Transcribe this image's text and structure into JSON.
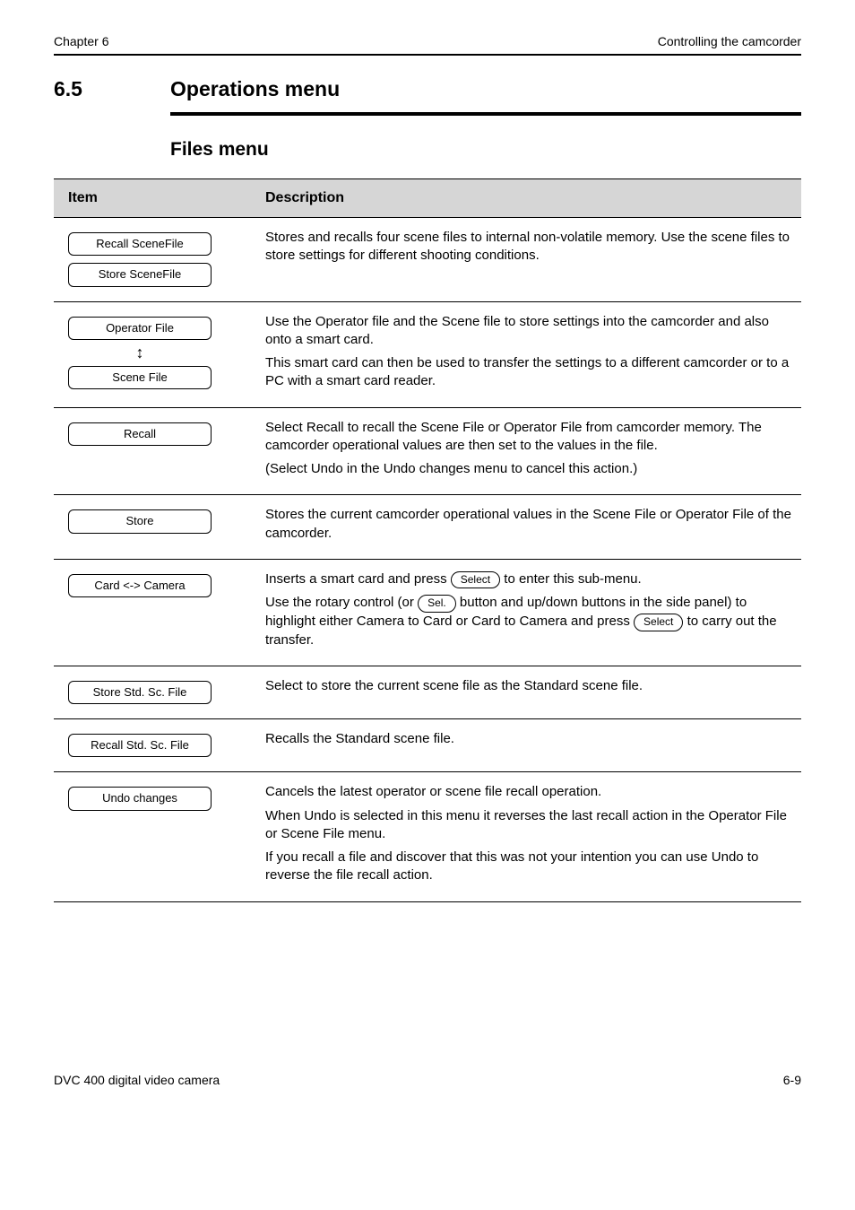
{
  "header": {
    "chapter_label": "Chapter 6",
    "chapter_title": "Controlling the camcorder"
  },
  "section": {
    "number": "6.5",
    "title": "Operations menu",
    "subheading": "Files menu"
  },
  "table": {
    "head": {
      "item": "Item",
      "description": "Description"
    },
    "rows": [
      {
        "buttons": [
          "Recall SceneFile",
          "Store SceneFile"
        ],
        "desc": [
          "Stores and recalls four scene files to internal non-volatile memory. Use the scene files to store settings for different shooting conditions."
        ]
      },
      {
        "buttons": [
          "Operator File",
          "Scene File"
        ],
        "has_updown": true,
        "desc": [
          "Use the Operator file and the Scene file to store settings into the camcorder and also onto a smart card.",
          "This smart card can then be used to transfer the settings to a different camcorder or to a PC with a smart card reader."
        ]
      },
      {
        "buttons": [
          "Recall"
        ],
        "desc": [
          "Select Recall to recall the Scene File or Operator File from camcorder memory. The camcorder operational values are then set to the values in the file.",
          "(Select Undo in the Undo changes menu to cancel this action.)"
        ]
      },
      {
        "buttons": [
          "Store"
        ],
        "desc": [
          "Stores the current camcorder operational values in the Scene File or Operator File of the camcorder."
        ]
      },
      {
        "buttons": [
          "Card <-> Camera"
        ],
        "btn_sm": [
          "Select",
          "Sel.",
          "Select"
        ],
        "desc_parts": {
          "p1_pre": "Inserts a smart card and press ",
          "p1_post": " to enter this sub-menu.",
          "p2_pre": "Use the rotary control (or ",
          "p2_post": " button and up/down buttons in the side panel) to highlight either Camera to Card or Card to Camera and press ",
          "p2_end": " to carry out the transfer."
        }
      },
      {
        "buttons": [
          "Store Std. Sc. File"
        ],
        "desc": [
          "Select to store the current scene file as the Standard scene file."
        ]
      },
      {
        "buttons": [
          "Recall Std. Sc. File"
        ],
        "desc": [
          "Recalls the Standard scene file."
        ]
      },
      {
        "buttons": [
          "Undo changes"
        ],
        "desc": [
          "Cancels the latest operator or scene file recall operation.",
          "When Undo is selected in this menu it reverses the last recall action in the Operator File or Scene File menu.",
          "If you recall a file and discover that this was not your intention you can use Undo to reverse the file recall action."
        ]
      }
    ]
  },
  "footer": {
    "model": "DVC 400 digital video camera",
    "page": "6-9"
  }
}
